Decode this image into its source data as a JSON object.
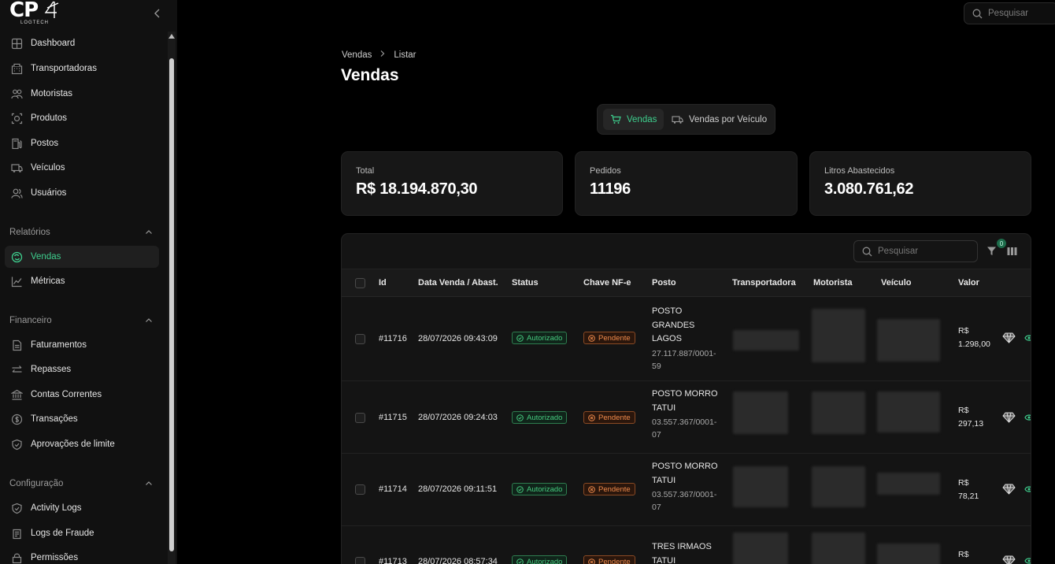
{
  "app": {
    "logo_text": "CP",
    "logo_subtext": "LOGTECH"
  },
  "sidebar": {
    "items": [
      {
        "label": "Dashboard",
        "icon": "dashboard-icon"
      },
      {
        "label": "Transportadoras",
        "icon": "building-icon"
      },
      {
        "label": "Motoristas",
        "icon": "users-icon"
      },
      {
        "label": "Produtos",
        "icon": "product-icon"
      },
      {
        "label": "Postos",
        "icon": "fuel-icon"
      },
      {
        "label": "Veículos",
        "icon": "truck-icon"
      },
      {
        "label": "Usuários",
        "icon": "user-group-icon"
      }
    ],
    "sections": {
      "relatorios": "Relatórios",
      "financeiro": "Financeiro",
      "configuracao": "Configuração"
    },
    "relatorios_items": [
      {
        "label": "Vendas",
        "icon": "sales-icon",
        "active": true
      },
      {
        "label": "Métricas",
        "icon": "chart-line-icon"
      }
    ],
    "financeiro_items": [
      {
        "label": "Faturamentos",
        "icon": "document-icon"
      },
      {
        "label": "Repasses",
        "icon": "transfer-icon"
      },
      {
        "label": "Contas Correntes",
        "icon": "bank-icon"
      },
      {
        "label": "Transações",
        "icon": "coin-icon"
      },
      {
        "label": "Aprovações de limite",
        "icon": "shield-check-icon"
      }
    ],
    "config_items": [
      {
        "label": "Activity Logs",
        "icon": "shield-icon"
      },
      {
        "label": "Logs de Fraude",
        "icon": "clipboard-icon"
      },
      {
        "label": "Permissões",
        "icon": "lock-icon"
      }
    ]
  },
  "top_search": {
    "placeholder": "Pesquisar"
  },
  "breadcrumb": {
    "root": "Vendas",
    "current": "Listar"
  },
  "page_title": "Vendas",
  "view_toggle": {
    "sales": "Vendas",
    "by_vehicle": "Vendas por Veículo"
  },
  "stats": [
    {
      "label": "Total",
      "value": "R$ 18.194.870,30"
    },
    {
      "label": "Pedidos",
      "value": "11196"
    },
    {
      "label": "Litros Abastecidos",
      "value": "3.080.761,62"
    }
  ],
  "table": {
    "search_placeholder": "Pesquisar",
    "filter_count": "0",
    "columns": [
      "Id",
      "Data Venda / Abast.",
      "Status",
      "Chave NF-e",
      "Posto",
      "Transportadora",
      "Motorista",
      "Veículo",
      "Valor"
    ],
    "rows": [
      {
        "id": "#11716",
        "date": "28/07/2026 09:43:09",
        "status": "Autorizado",
        "nfe": "Pendente",
        "posto_name": "POSTO GRANDES LAGOS",
        "posto_cnpj": "27.117.887/0001-59",
        "valor_currency": "R$",
        "valor": "1.298,00"
      },
      {
        "id": "#11715",
        "date": "28/07/2026 09:24:03",
        "status": "Autorizado",
        "nfe": "Pendente",
        "posto_name": "POSTO MORRO TATUI",
        "posto_cnpj": "03.557.367/0001-07",
        "valor_currency": "R$",
        "valor": "297,13"
      },
      {
        "id": "#11714",
        "date": "28/07/2026 09:11:51",
        "status": "Autorizado",
        "nfe": "Pendente",
        "posto_name": "POSTO MORRO TATUI",
        "posto_cnpj": "03.557.367/0001-07",
        "valor_currency": "R$",
        "valor": "78,21"
      },
      {
        "id": "#11713",
        "date": "28/07/2026 08:57:34",
        "status": "Autorizado",
        "nfe": "Pendente",
        "posto_name": "TRES IRMAOS TATUI",
        "posto_cnpj": "",
        "valor_currency": "R$",
        "valor": ""
      }
    ]
  },
  "colors": {
    "accent": "#3ecf8e",
    "pending": "#f08a4b",
    "background": "#000000",
    "card": "#171717"
  }
}
